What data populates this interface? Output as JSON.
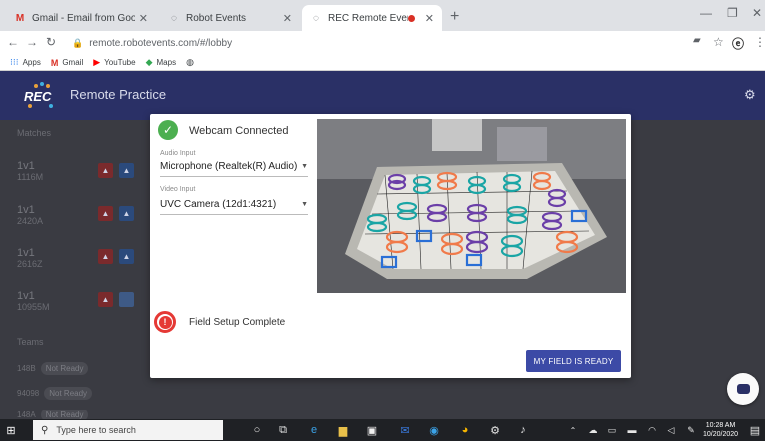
{
  "browser": {
    "tabs": [
      {
        "title": "Gmail - Email from Google",
        "icon": "gmail-icon",
        "active": false
      },
      {
        "title": "Robot Events",
        "icon": "loading-icon",
        "active": false
      },
      {
        "title": "REC Remote Events",
        "icon": "loading-icon",
        "active": true,
        "recording": true
      }
    ],
    "url": "remote.robotevents.com/#/lobby",
    "bookmarks": [
      {
        "label": "Apps",
        "icon": "apps-grid-icon"
      },
      {
        "label": "Gmail",
        "icon": "gmail-icon"
      },
      {
        "label": "YouTube",
        "icon": "youtube-icon"
      },
      {
        "label": "Maps",
        "icon": "maps-icon"
      },
      {
        "label": "",
        "icon": "globe-icon"
      }
    ]
  },
  "app": {
    "logo": "REC",
    "title": "Remote Practice",
    "accent": "#2a3066"
  },
  "sidebar": {
    "matches_heading": "Matches",
    "matches": [
      {
        "type": "1v1",
        "team": "1116M"
      },
      {
        "type": "1v1",
        "team": "2420A"
      },
      {
        "type": "1v1",
        "team": "2616Z"
      },
      {
        "type": "1v1",
        "team": "10955M"
      }
    ],
    "teams_heading": "Teams",
    "teams": [
      {
        "name": "148B",
        "status": "Not Ready"
      },
      {
        "name": "94098",
        "status": "Not Ready"
      },
      {
        "name": "148A",
        "status": "Not Ready"
      }
    ]
  },
  "modal": {
    "webcam_status": "Webcam Connected",
    "audio_label": "Audio Input",
    "audio_value": "Microphone (Realtek(R) Audio)",
    "video_label": "Video Input",
    "video_value": "UVC Camera (12d1:4321)",
    "field_status": "Field Setup Complete",
    "ready_button": "MY FIELD IS READY",
    "success_color": "#4caf50",
    "error_color": "#e53935"
  },
  "taskbar": {
    "search_placeholder": "Type here to search",
    "time": "10:28 AM",
    "date": "10/20/2020"
  }
}
